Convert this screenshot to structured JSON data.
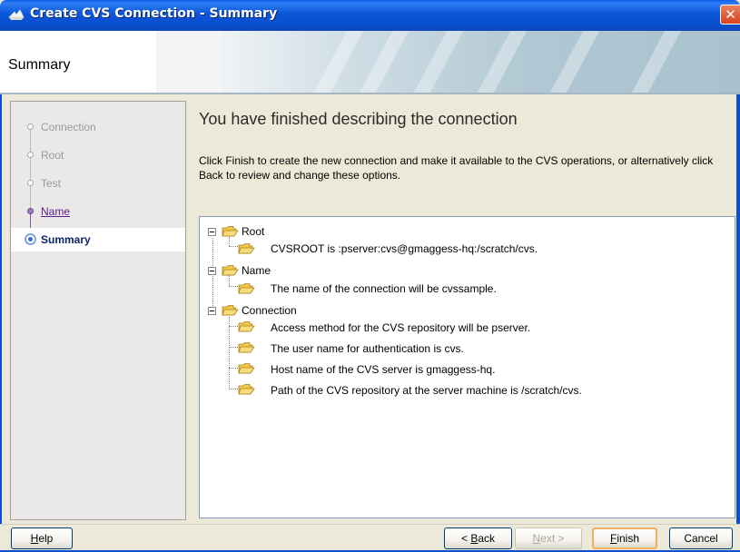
{
  "window": {
    "title": "Create CVS Connection - Summary",
    "close_glyph": "✕"
  },
  "header": {
    "title": "Summary"
  },
  "steps": [
    {
      "label": "Connection",
      "state": "done"
    },
    {
      "label": "Root",
      "state": "done"
    },
    {
      "label": "Test",
      "state": "done"
    },
    {
      "label": "Name",
      "state": "link"
    },
    {
      "label": "Summary",
      "state": "current"
    }
  ],
  "main": {
    "title": "You have finished describing the connection",
    "description": "Click Finish to create the new connection and make it available to the CVS operations, or alternatively click Back to review and change these options."
  },
  "tree": {
    "groups": [
      {
        "label": "Root",
        "children": [
          "CVSROOT is :pserver:cvs@gmaggess-hq:/scratch/cvs."
        ]
      },
      {
        "label": "Name",
        "children": [
          "The name of the connection will be cvssample."
        ]
      },
      {
        "label": "Connection",
        "children": [
          "Access method for the CVS repository will be pserver.",
          "The user name for authentication is cvs.",
          "Host name of the CVS server is gmaggess-hq.",
          "Path of the CVS repository at the server machine is /scratch/cvs."
        ]
      }
    ]
  },
  "buttons": {
    "help": {
      "before": "",
      "mnemonic": "H",
      "after": "elp"
    },
    "back": {
      "before": "< ",
      "mnemonic": "B",
      "after": "ack"
    },
    "next": {
      "before": "",
      "mnemonic": "N",
      "after": "ext >"
    },
    "finish": {
      "before": "",
      "mnemonic": "F",
      "after": "inish"
    },
    "cancel": {
      "before": "",
      "mnemonic": "",
      "after": "Cancel"
    }
  },
  "colors": {
    "titlebar": "#0a4fcf",
    "link": "#5c1a8a",
    "current_step": "#0a246a",
    "folder": "#f2c94c"
  }
}
